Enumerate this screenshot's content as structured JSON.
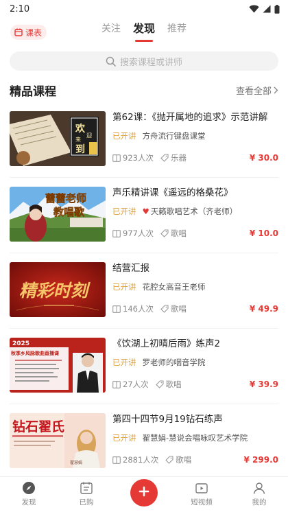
{
  "status_bar": {
    "time": "2:10"
  },
  "header": {
    "kebiao_label": "课表",
    "tabs": [
      {
        "label": "关注",
        "active": false
      },
      {
        "label": "发现",
        "active": true
      },
      {
        "label": "推荐",
        "active": false
      }
    ]
  },
  "search": {
    "placeholder": "搜索课程或讲师"
  },
  "section": {
    "title": "精品课程",
    "view_all": "查看全部"
  },
  "courses": [
    {
      "title": "第62课：《抛开属地的追求》示范讲解",
      "status": "已开讲",
      "teacher": "方舟流行键盘课堂",
      "students": "923人次",
      "tag": "乐器",
      "price": "¥ 30.0",
      "thumb_text": [
        "欢",
        "迎",
        "来",
        "到"
      ]
    },
    {
      "title": "声乐精讲课《遥远的格桑花》",
      "status": "已开讲",
      "teacher": "天籁歌唱艺术（齐老师）",
      "teacher_prefix": "♥",
      "students": "977人次",
      "tag": "歌唱",
      "price": "¥ 10.0",
      "thumb_text": [
        "蕾蕾老师",
        "教唱歌"
      ]
    },
    {
      "title": "结营汇报",
      "status": "已开讲",
      "teacher": "花腔女高音王老师",
      "students": "146人次",
      "tag": "歌唱",
      "price": "¥ 49.9",
      "thumb_text": [
        "精彩时刻"
      ]
    },
    {
      "title": "《饮湖上初晴后雨》练声2",
      "status": "已开讲",
      "teacher": "罗老师的咽音学院",
      "students": "27人次",
      "tag": "歌唱",
      "price": "¥ 39.9",
      "thumb_text": [
        "2025",
        "秋季乡风脉歌曲直播课"
      ]
    },
    {
      "title": "第四十四节9月19钻石练声",
      "status": "已开讲",
      "teacher": "翟慧娟-慧说会唱咏叹艺术学院",
      "students": "2881人次",
      "tag": "歌唱",
      "price": "¥ 299.0",
      "thumb_text": [
        "钻石翟氏",
        "翟慧娟"
      ]
    }
  ],
  "bottom_nav": [
    {
      "label": "发现",
      "icon": "compass-icon"
    },
    {
      "label": "已购",
      "icon": "purchased-icon"
    },
    {
      "label": "",
      "icon": "plus-icon"
    },
    {
      "label": "短视频",
      "icon": "video-icon"
    },
    {
      "label": "我的",
      "icon": "user-icon"
    }
  ],
  "colors": {
    "accent": "#e53935",
    "status": "#e0a23a"
  }
}
